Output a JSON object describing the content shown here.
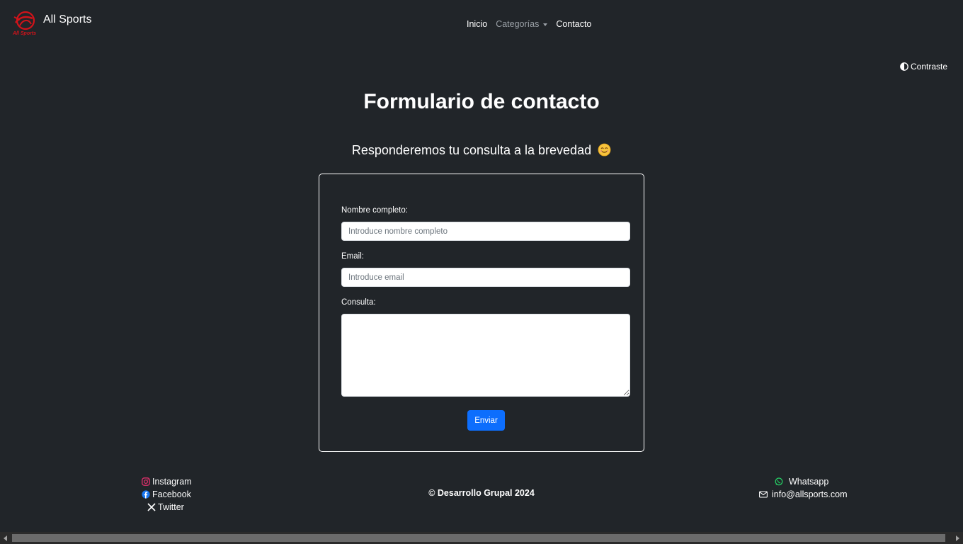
{
  "brand": {
    "name": "All Sports",
    "logo_text": "All Sports",
    "accent": "#d2131a"
  },
  "nav": {
    "items": [
      {
        "label": "Inicio"
      },
      {
        "label": "Categorías"
      },
      {
        "label": "Contacto"
      }
    ]
  },
  "contrast": {
    "label": "Contraste",
    "icon": "half-circle-icon"
  },
  "page": {
    "title": "Formulario de contacto",
    "subtitle": "Responderemos tu consulta a la brevedad",
    "subtitle_icon": "smiling-face-icon"
  },
  "form": {
    "name_label": "Nombre completo:",
    "name_placeholder": "Introduce nombre completo",
    "name_value": "",
    "email_label": "Email:",
    "email_placeholder": "Introduce email",
    "email_value": "",
    "query_label": "Consulta:",
    "query_value": "",
    "submit_label": "Enviar",
    "submit_color": "#0d6efd"
  },
  "footer": {
    "social": [
      {
        "label": "Instagram",
        "icon": "instagram-icon",
        "color": "#e1306c"
      },
      {
        "label": "Facebook",
        "icon": "facebook-icon",
        "color": "#1877f2"
      },
      {
        "label": "Twitter",
        "icon": "x-twitter-icon",
        "color": "#ffffff"
      }
    ],
    "copyright": "© Desarrollo Grupal 2024",
    "contact": [
      {
        "label": "Whatsapp",
        "icon": "whatsapp-icon",
        "color": "#25d366"
      },
      {
        "label": "info@allsports.com",
        "icon": "envelope-icon",
        "color": "#ffffff"
      }
    ]
  },
  "theme": {
    "background": "#212529",
    "text": "#ffffff"
  }
}
